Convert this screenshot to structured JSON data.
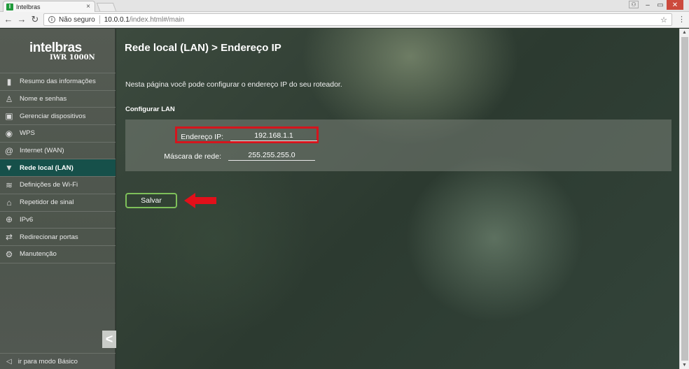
{
  "browser": {
    "tab_title": "Intelbras",
    "favicon_letter": "I",
    "tab_close": "×",
    "security_label": "Não seguro",
    "url_host": "10.0.0.1",
    "url_path": "/index.html#/main",
    "window_controls": {
      "user": "⚇",
      "minimize": "–",
      "maximize": "▭",
      "close": "✕"
    },
    "nav": {
      "back": "←",
      "forward": "→",
      "reload": "↻"
    }
  },
  "brand": {
    "logo": "intelbras",
    "model": "IWR 1000N"
  },
  "sidebar": {
    "items": [
      {
        "label": "Resumo das informações",
        "icon": "bar-chart-icon",
        "glyph": "▮",
        "active": false
      },
      {
        "label": "Nome e senhas",
        "icon": "user-icon",
        "glyph": "♙",
        "active": false
      },
      {
        "label": "Gerenciar dispositivos",
        "icon": "device-icon",
        "glyph": "▣",
        "active": false
      },
      {
        "label": "WPS",
        "icon": "wps-icon",
        "glyph": "◉",
        "active": false
      },
      {
        "label": "Internet (WAN)",
        "icon": "at-icon",
        "glyph": "@",
        "active": false
      },
      {
        "label": "Rede local (LAN)",
        "icon": "lan-icon",
        "glyph": "▼",
        "active": true
      },
      {
        "label": "Definições de Wi-Fi",
        "icon": "wifi-icon",
        "glyph": "≋",
        "active": false
      },
      {
        "label": "Repetidor de sinal",
        "icon": "repeater-icon",
        "glyph": "⌂",
        "active": false
      },
      {
        "label": "IPv6",
        "icon": "globe-icon",
        "glyph": "⊕",
        "active": false
      },
      {
        "label": "Redirecionar portas",
        "icon": "port-forward-icon",
        "glyph": "⇄",
        "active": false
      },
      {
        "label": "Manutenção",
        "icon": "gear-icon",
        "glyph": "⚙",
        "active": false
      }
    ],
    "collapse_glyph": "<",
    "basic_mode": {
      "label": "ir para modo Básico",
      "glyph": "◁"
    }
  },
  "main": {
    "title": "Rede local (LAN) > Endereço IP",
    "description": "Nesta página você pode configurar o endereço IP do seu roteador.",
    "section_title": "Configurar LAN",
    "fields": {
      "ip": {
        "label": "Endereço IP:",
        "value": "192.168.1.1"
      },
      "mask": {
        "label": "Máscara de rede:",
        "value": "255.255.255.0"
      }
    },
    "save_label": "Salvar"
  },
  "colors": {
    "highlight": "#d5151d",
    "active_nav": "#16504a",
    "save_border": "#7ec05a",
    "arrow": "#e2101a"
  }
}
